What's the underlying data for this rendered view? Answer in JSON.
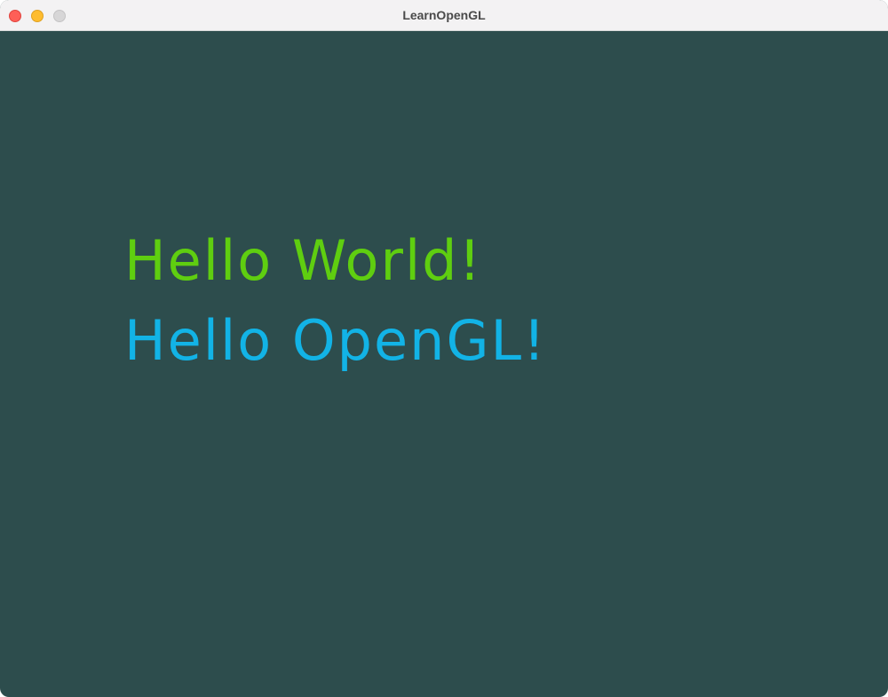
{
  "window": {
    "title": "LearnOpenGL",
    "background_color": "#2d4d4d",
    "controls": [
      {
        "name": "close",
        "color": "#fe5f57",
        "border": "#e0443e"
      },
      {
        "name": "minimize",
        "color": "#febc2e",
        "border": "#dea123"
      },
      {
        "name": "zoom",
        "color": "#d7d6d7",
        "border": "#c4c3c4"
      }
    ]
  },
  "scene": {
    "lines": [
      {
        "text": "Hello World!",
        "color": "#5fce10"
      },
      {
        "text": "Hello OpenGL!",
        "color": "#12b3e6"
      }
    ]
  }
}
